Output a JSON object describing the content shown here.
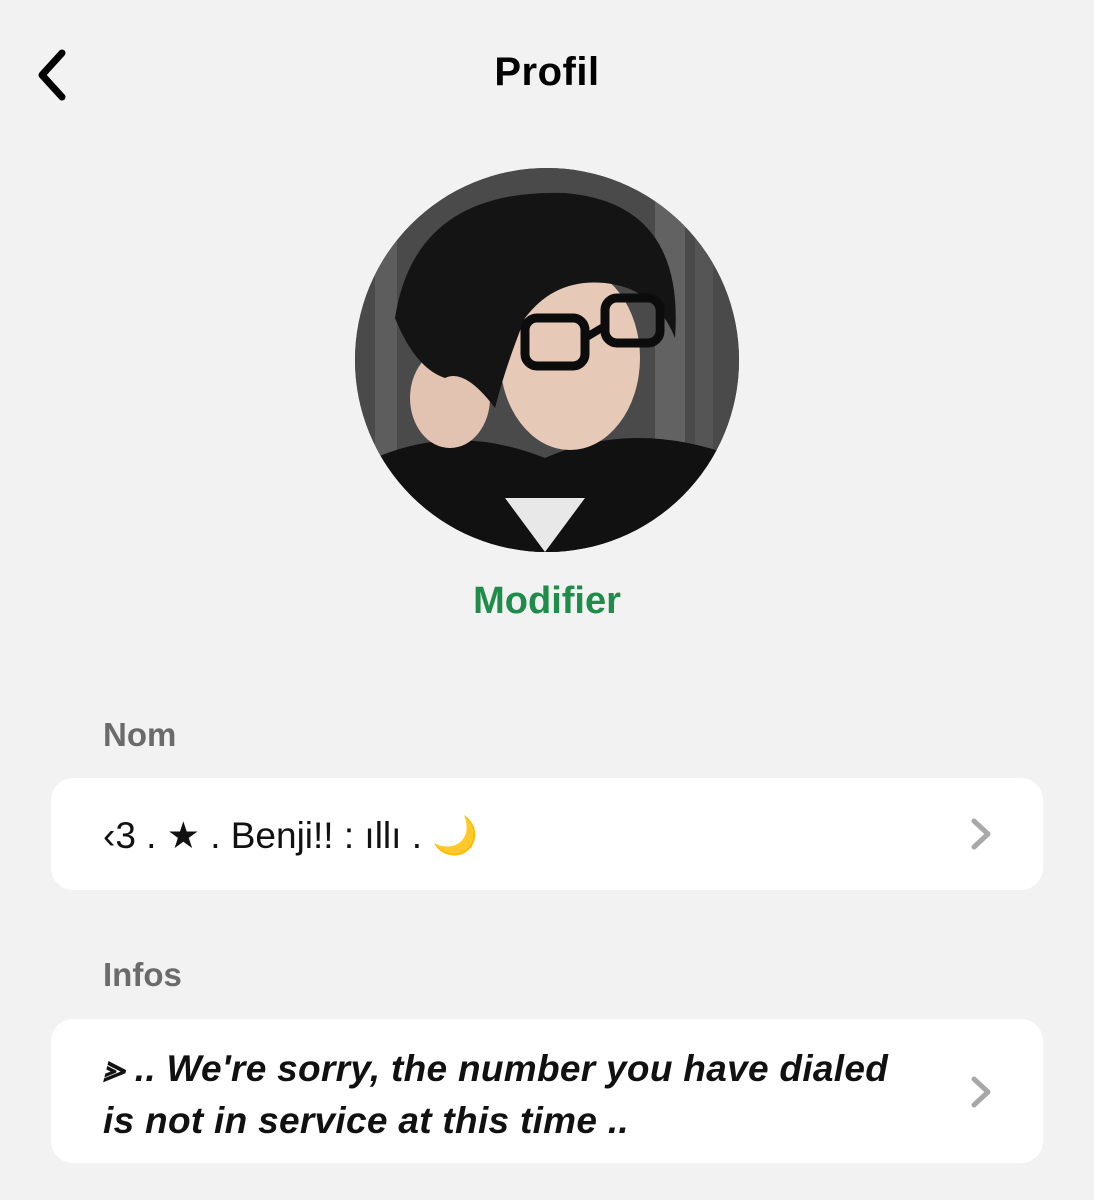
{
  "header": {
    "title": "Profil",
    "back_icon": "chevron-left-icon"
  },
  "profile": {
    "edit_label": "Modifier",
    "accent_color": "#1f8c4a"
  },
  "fields": [
    {
      "label": "Nom",
      "value": "‹3 . ★ . Benji!! : ıllı . 🌙"
    },
    {
      "label": "Infos",
      "value": "⪢ .. We're sorry, the number you have dialed is not in service at this time .."
    }
  ],
  "row_icon": "chevron-right-icon"
}
